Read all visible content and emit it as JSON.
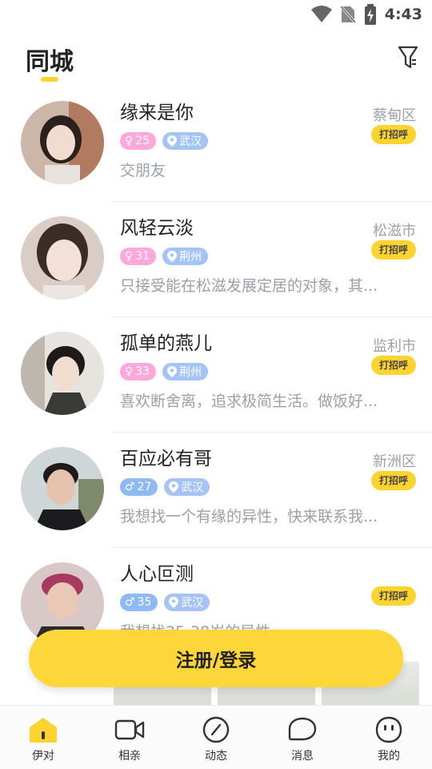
{
  "status": {
    "time": "4:43"
  },
  "header": {
    "title": "同城"
  },
  "users": [
    {
      "name": "缘来是你",
      "gender": "female",
      "age": "25",
      "city": "武汉",
      "location": "蔡甸区",
      "greet": "打招呼",
      "bio": "交朋友"
    },
    {
      "name": "风轻云淡",
      "gender": "female",
      "age": "31",
      "city": "荆州",
      "location": "松滋市",
      "greet": "打招呼",
      "bio": "只接受能在松滋发展定居的对象，其..."
    },
    {
      "name": "孤单的燕儿",
      "gender": "female",
      "age": "33",
      "city": "荆州",
      "location": "监利市",
      "greet": "打招呼",
      "bio": "喜欢断舍离，追求极简生活。做饭好..."
    },
    {
      "name": "百应必有哥",
      "gender": "male",
      "age": "27",
      "city": "武汉",
      "location": "新洲区",
      "greet": "打招呼",
      "bio": "我想找一个有缘的异性，快来联系我..."
    },
    {
      "name": "人心叵测",
      "gender": "male",
      "age": "35",
      "city": "武汉",
      "location": "",
      "greet": "打招呼",
      "bio": "我想找25-38岁的异性"
    }
  ],
  "login_button": "注册/登录",
  "tabbar": [
    {
      "label": "伊对",
      "icon": "home-icon",
      "active": true
    },
    {
      "label": "相亲",
      "icon": "video-camera-icon",
      "active": false
    },
    {
      "label": "动态",
      "icon": "compass-icon",
      "active": false
    },
    {
      "label": "消息",
      "icon": "message-icon",
      "active": false
    },
    {
      "label": "我的",
      "icon": "profile-icon",
      "active": false
    }
  ],
  "colors": {
    "accent": "#fdd32f",
    "female": "#fda8d8",
    "male": "#8db9f5",
    "city": "#a4c4f7",
    "muted": "#9aa0a6"
  }
}
